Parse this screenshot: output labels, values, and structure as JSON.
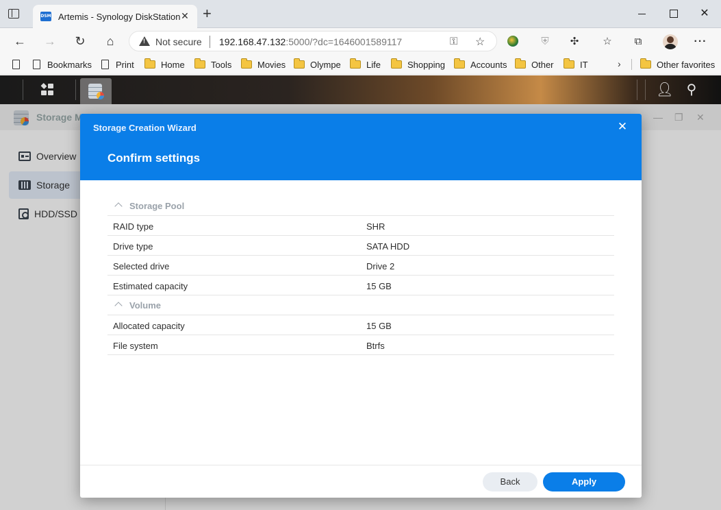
{
  "browser": {
    "tab": {
      "favicon_text": "DSM",
      "title": "Artemis - Synology DiskStation"
    },
    "address": {
      "security_label": "Not secure",
      "host": "192.168.47.132",
      "rest": ":5000/?dc=1646001589117"
    },
    "bookmarks": [
      "Bookmarks",
      "Print",
      "Home",
      "Tools",
      "Movies",
      "Olympe",
      "Life",
      "Shopping",
      "Accounts",
      "Other",
      "IT"
    ],
    "other_favorites": "Other favorites"
  },
  "dsm": {
    "window_title": "Storage Manager",
    "sidebar": [
      {
        "label": "Overview",
        "icon": "overview-icon",
        "active": false
      },
      {
        "label": "Storage",
        "icon": "storage-icon",
        "active": true
      },
      {
        "label": "HDD/SSD",
        "icon": "hdd-icon",
        "active": false
      }
    ]
  },
  "wizard": {
    "title": "Storage Creation Wizard",
    "step_title": "Confirm settings",
    "groups": [
      {
        "name": "Storage Pool",
        "rows": [
          {
            "key": "RAID type",
            "value": "SHR"
          },
          {
            "key": "Drive type",
            "value": "SATA HDD"
          },
          {
            "key": "Selected drive",
            "value": "Drive 2"
          },
          {
            "key": "Estimated capacity",
            "value": "15 GB"
          }
        ]
      },
      {
        "name": "Volume",
        "rows": [
          {
            "key": "Allocated capacity",
            "value": "15 GB"
          },
          {
            "key": "File system",
            "value": "Btrfs"
          }
        ]
      }
    ],
    "buttons": {
      "back": "Back",
      "apply": "Apply"
    }
  },
  "colors": {
    "accent": "#0a7ee8",
    "header_text": "#ffffff",
    "group_text": "#9aa2aa"
  }
}
